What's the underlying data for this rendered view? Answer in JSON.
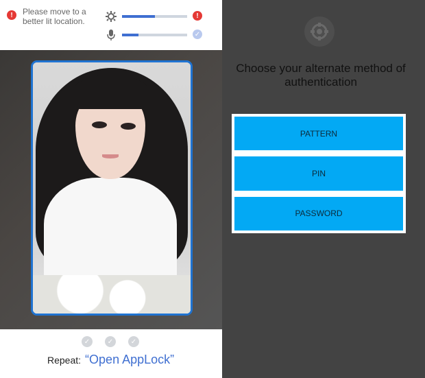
{
  "status": {
    "message": "Please move to a better lit location.",
    "brightness_level": 0.5,
    "mic_level": 0.25
  },
  "bottom": {
    "repeat_label": "Repeat:",
    "repeat_phrase": "“Open AppLock”",
    "progress_steps": 3
  },
  "auth": {
    "heading": "Choose your alternate method of authentication",
    "options": [
      "PATTERN",
      "PIN",
      "PASSWORD"
    ]
  },
  "colors": {
    "accent": "#03a9f4",
    "frame": "#1f73d1",
    "warning": "#e53935"
  },
  "icons": [
    "warning-icon",
    "brightness-icon",
    "microphone-icon",
    "check-icon",
    "lock-icon"
  ]
}
